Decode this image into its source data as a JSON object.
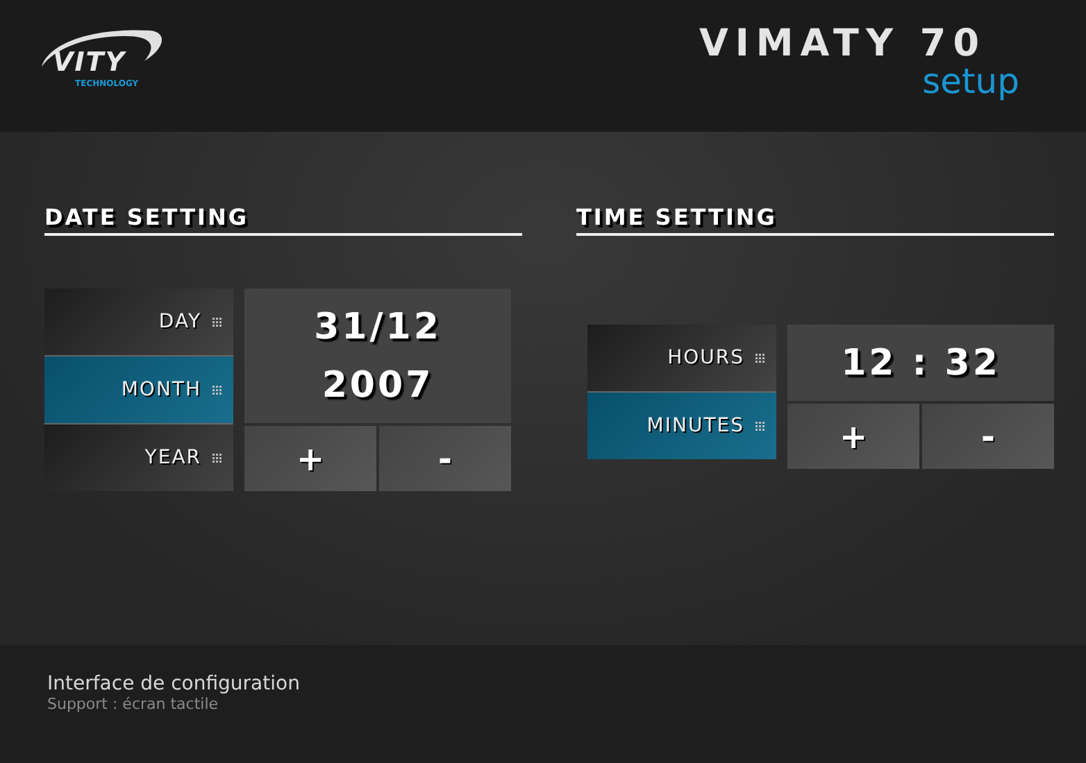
{
  "header": {
    "logo": {
      "name": "VITY",
      "tagline": "TECHNOLOGY"
    },
    "title": "VIMATY 70",
    "subtitle": "setup"
  },
  "sections": [
    {
      "title": "DATE SETTING",
      "fields": [
        {
          "label": "DAY",
          "selected": false
        },
        {
          "label": "MONTH",
          "selected": true
        },
        {
          "label": "YEAR",
          "selected": false
        }
      ],
      "value_lines": [
        "31/12",
        "2007"
      ],
      "buttons": [
        "+",
        "-"
      ]
    },
    {
      "title": "TIME SETTING",
      "fields": [
        {
          "label": "HOURS",
          "selected": false
        },
        {
          "label": "MINUTES",
          "selected": true
        }
      ],
      "value_lines": [
        "12 : 32"
      ],
      "buttons": [
        "+",
        "-"
      ]
    }
  ],
  "footer": {
    "title": "Interface de configuration",
    "subtitle": "Support : écran tactile"
  }
}
